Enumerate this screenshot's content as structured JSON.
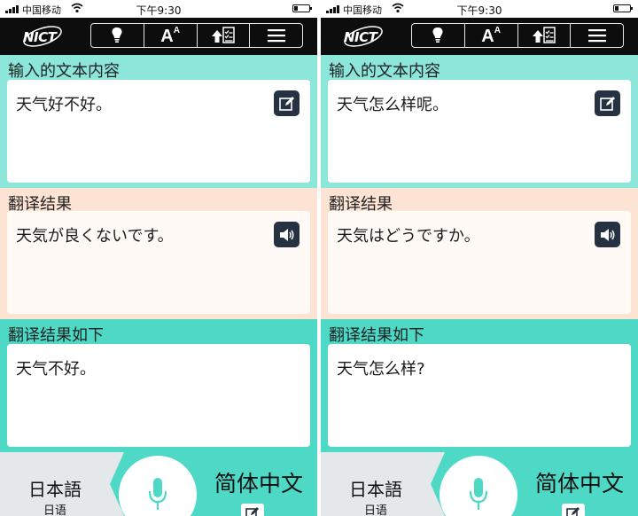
{
  "status_bar": {
    "carrier": "中国移动",
    "time": "下午9:30",
    "icons": [
      "signal-icon",
      "wifi-icon",
      "battery-icon"
    ]
  },
  "toolbar": {
    "logo_text": "NICT",
    "buttons": [
      "lightbulb-icon",
      "font-size-icon",
      "upload-checklist-icon",
      "menu-icon"
    ],
    "font_size_label": "A",
    "font_size_sup": "A"
  },
  "screens": [
    {
      "input_title": "输入的文本内容",
      "input_text": "天气好不好。",
      "translation_title": "翻译结果",
      "translation_text": "天気が良くないです。",
      "back_title": "翻译结果如下",
      "back_text": "天气不好。",
      "source_language": "日本語",
      "source_language_sub": "日语",
      "target_language": "简体中文"
    },
    {
      "input_title": "输入的文本内容",
      "input_text": "天气怎么样呢。",
      "translation_title": "翻译结果",
      "translation_text": "天気はどうですか。",
      "back_title": "翻译结果如下",
      "back_text": "天气怎么样?",
      "source_language": "日本語",
      "source_language_sub": "日语",
      "target_language": "简体中文"
    }
  ],
  "colors": {
    "input_bg": "#8ce6da",
    "translation_bg": "#fde3d3",
    "back_bg": "#4dd9c6",
    "toolbar_bg": "#0d0d0d",
    "icon_button_bg": "#263142"
  }
}
